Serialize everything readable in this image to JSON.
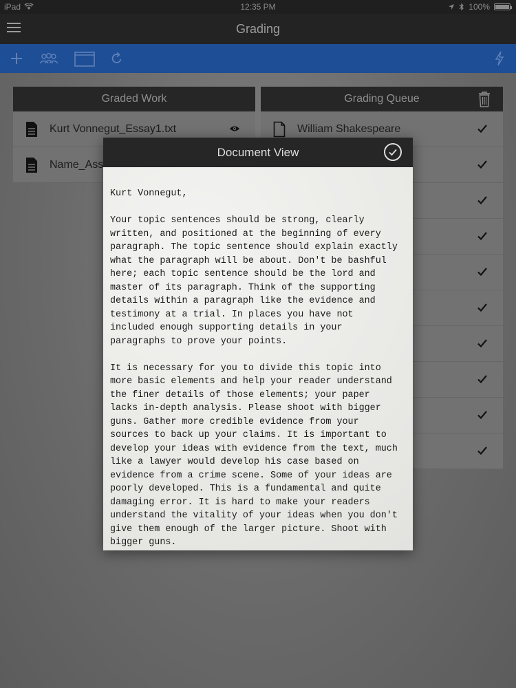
{
  "status_bar": {
    "device": "iPad",
    "time": "12:35 PM",
    "battery": "100%"
  },
  "nav": {
    "title": "Grading"
  },
  "graded_work": {
    "header": "Graded Work",
    "items": [
      {
        "label": "Kurt Vonnegut_Essay1.txt"
      },
      {
        "label": "Name_Assi"
      }
    ]
  },
  "grading_queue": {
    "header": "Grading Queue",
    "items": [
      {
        "label": "William Shakespeare"
      },
      {
        "label": ""
      },
      {
        "label": ""
      },
      {
        "label": ""
      },
      {
        "label": ""
      },
      {
        "label": ""
      },
      {
        "label": ""
      },
      {
        "label": ""
      },
      {
        "label": ""
      },
      {
        "label": ""
      }
    ]
  },
  "document_view": {
    "title": "Document View",
    "salutation": "Kurt Vonnegut,",
    "paragraph_1": "Your topic sentences should be strong, clearly\nwritten, and positioned at the beginning of every\nparagraph. The topic sentence should explain exactly\nwhat the paragraph will be about. Don't be bashful\nhere; each topic sentence should be the lord and\nmaster of its paragraph. Think of the supporting\ndetails within a paragraph like the evidence and\ntestimony at a trial. In places you have not\nincluded enough supporting details in your\nparagraphs to prove your points.",
    "paragraph_2": "It is necessary for you to divide this topic into\nmore basic elements and help your reader understand\nthe finer details of those elements; your paper\nlacks in-depth analysis. Please shoot with bigger\nguns. Gather more credible evidence from your\nsources to back up your claims. It is important to\ndevelop your ideas with evidence from the text, much\nlike a lawyer would develop his case based on\nevidence from a crime scene. Some of your ideas are\npoorly developed. This is a fundamental and quite\ndamaging error. It is hard to make your readers\nunderstand the vitality of your ideas when you don't\ngive them enough of the larger picture. Shoot with\nbigger guns."
  }
}
